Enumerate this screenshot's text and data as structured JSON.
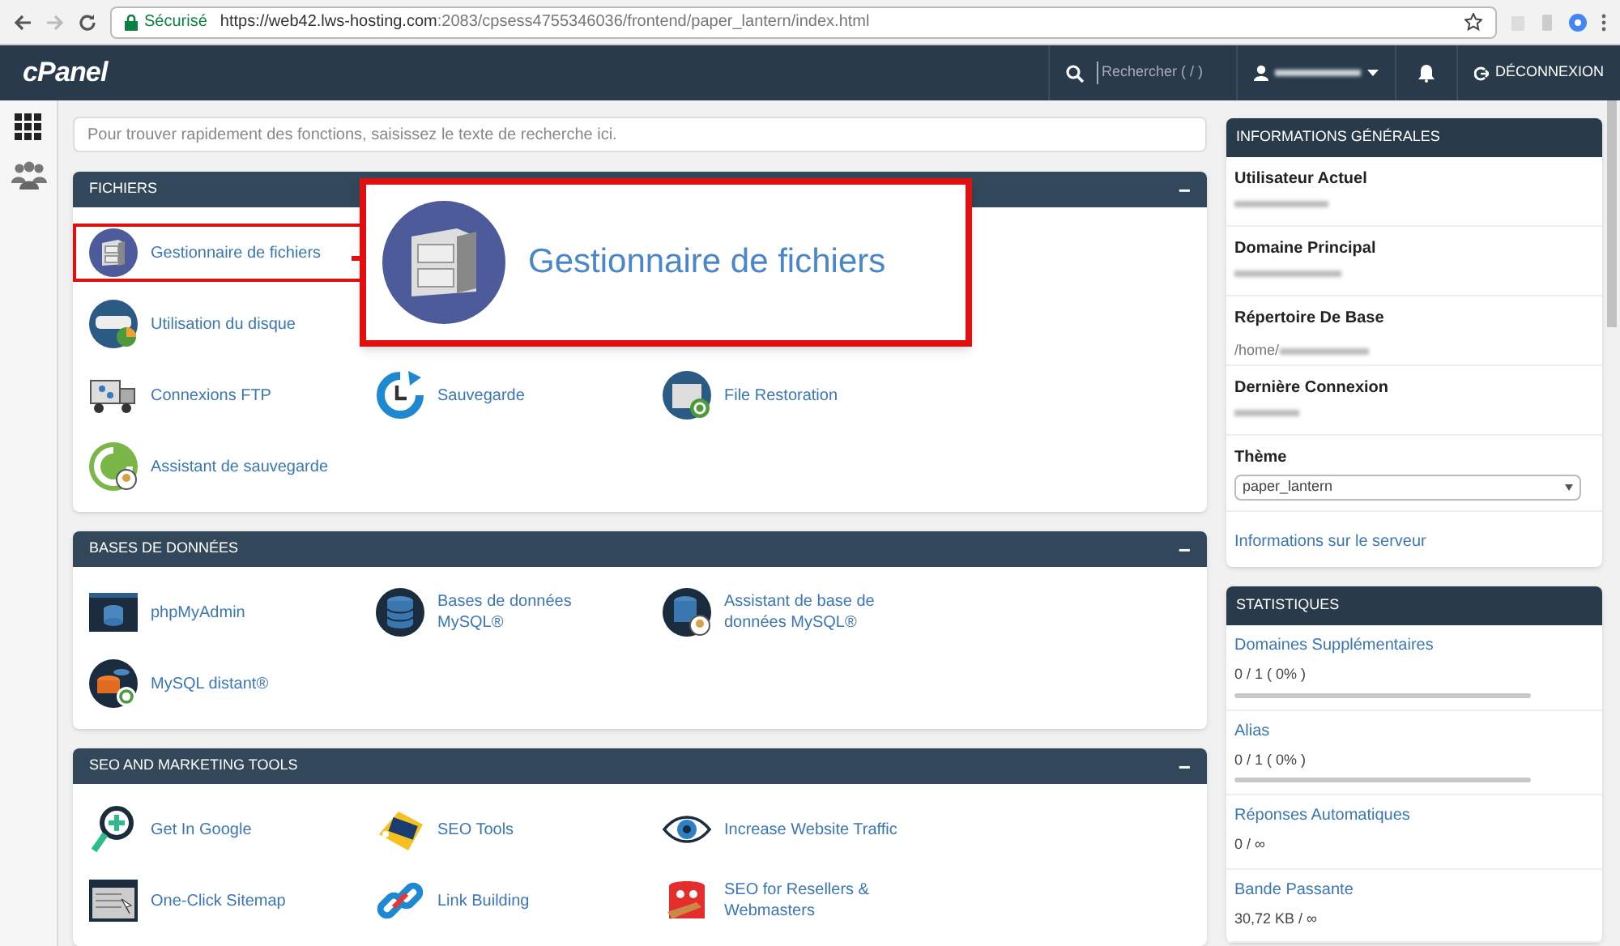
{
  "browser": {
    "security_label": "Sécurisé",
    "url_host": "https://web42.lws-hosting.com",
    "url_path": ":2083/cpsess4755346036/frontend/paper_lantern/index.html"
  },
  "header": {
    "logo": "cPanel",
    "search_placeholder": "Rechercher ( / )",
    "logout": "DÉCONNEXION"
  },
  "search": {
    "placeholder": "Pour trouver rapidement des fonctions, saisissez le texte de recherche ici."
  },
  "sections": [
    {
      "title": "FICHIERS",
      "collapse": "−",
      "rows": [
        [
          {
            "label": "Gestionnaire de fichiers",
            "highlighted": true
          }
        ],
        [
          {
            "label": "Utilisation du disque",
            "highlighted": false
          }
        ],
        [
          {
            "label": "Connexions FTP",
            "highlighted": false
          },
          {
            "label": "Sauvegarde",
            "highlighted": false
          },
          {
            "label": "File Restoration",
            "highlighted": false
          }
        ],
        [
          {
            "label": "Assistant de sauvegarde",
            "highlighted": false
          }
        ]
      ]
    },
    {
      "title": "BASES DE DONNÉES",
      "collapse": "−",
      "rows": [
        [
          {
            "label": "phpMyAdmin",
            "highlighted": false
          },
          {
            "label": "Bases de données MySQL®",
            "highlighted": false
          },
          {
            "label": "Assistant de base de données MySQL®",
            "highlighted": false
          }
        ],
        [
          {
            "label": "MySQL distant®",
            "highlighted": false
          }
        ]
      ]
    },
    {
      "title": "SEO AND MARKETING TOOLS",
      "collapse": "−",
      "rows": [
        [
          {
            "label": "Get In Google",
            "highlighted": false
          },
          {
            "label": "SEO Tools",
            "highlighted": false
          },
          {
            "label": "Increase Website Traffic",
            "highlighted": false
          }
        ],
        [
          {
            "label": "One-Click Sitemap",
            "highlighted": false
          },
          {
            "label": "Link Building",
            "highlighted": false
          },
          {
            "label": "SEO for Resellers & Webmasters",
            "highlighted": false
          }
        ]
      ]
    }
  ],
  "callout": {
    "label": "Gestionnaire de fichiers"
  },
  "general_info": {
    "title": "INFORMATIONS GÉNÉRALES",
    "fields": [
      {
        "label": "Utilisateur Actuel"
      },
      {
        "label": "Domaine Principal"
      },
      {
        "label": "Répertoire De Base",
        "value": "/home/"
      },
      {
        "label": "Dernière Connexion"
      }
    ],
    "theme_label": "Thème",
    "theme_value": "paper_lantern",
    "server_link": "Informations sur le serveur"
  },
  "statistics": {
    "title": "STATISTIQUES",
    "items": [
      {
        "label": "Domaines Supplémentaires",
        "value": "0 / 1 ( 0% )",
        "level": 0
      },
      {
        "label": "Alias",
        "value": "0 / 1 ( 0% )",
        "level": 0
      },
      {
        "label": "Réponses Automatiques",
        "value": "0 / ∞"
      },
      {
        "label": "Bande Passante",
        "value": "30,72 KB / ∞"
      }
    ]
  }
}
